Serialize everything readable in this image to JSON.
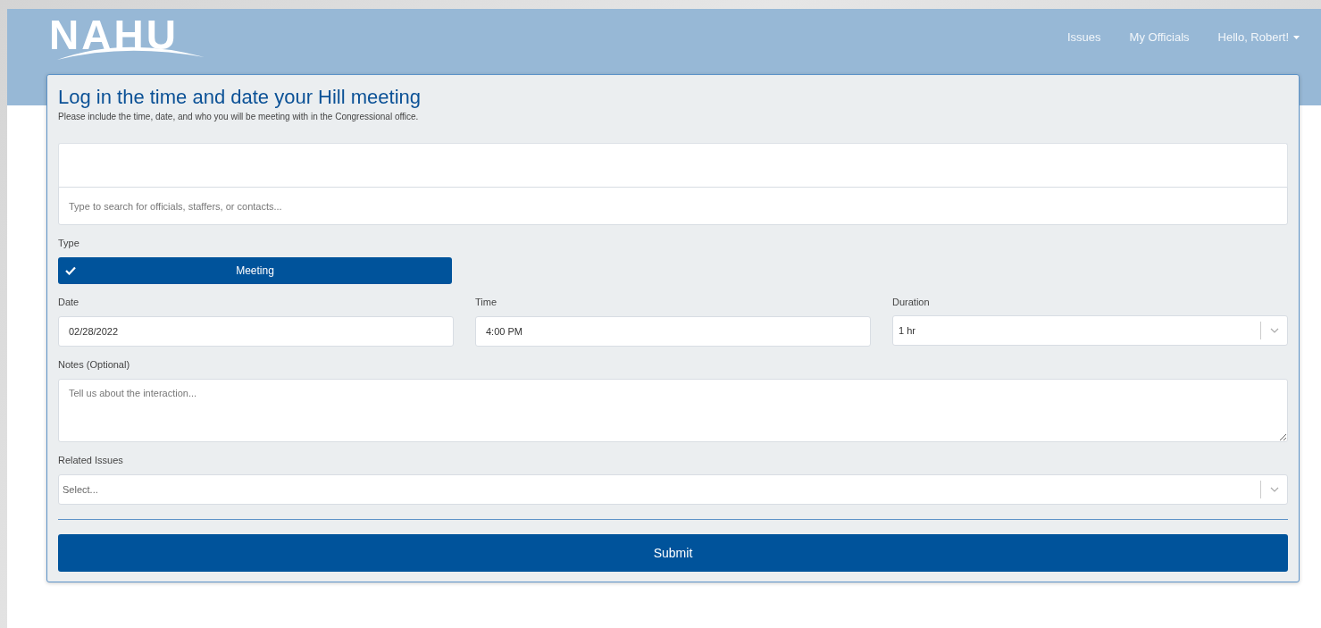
{
  "header": {
    "logo": "NAHU",
    "nav": [
      {
        "label": "Issues",
        "kind": "link"
      },
      {
        "label": "My Officials",
        "kind": "link"
      },
      {
        "label": "Hello, Robert!",
        "kind": "dropdown"
      }
    ]
  },
  "form": {
    "title": "Log in the time and date your Hill meeting",
    "subtitle": "Please include the time, date, and who you will be meeting with in the Congressional office.",
    "search": {
      "placeholder": "Type to search for officials, staffers, or contacts..."
    },
    "type": {
      "label": "Type",
      "options": [
        {
          "label": "Meeting",
          "selected": true
        }
      ]
    },
    "date": {
      "label": "Date",
      "value": "02/28/2022"
    },
    "time": {
      "label": "Time",
      "value": "4:00 PM"
    },
    "duration": {
      "label": "Duration",
      "value": "1 hr"
    },
    "notes": {
      "label": "Notes (Optional)",
      "placeholder": "Tell us about the interaction..."
    },
    "related_issues": {
      "label": "Related Issues",
      "placeholder": "Select..."
    },
    "submit": "Submit"
  }
}
